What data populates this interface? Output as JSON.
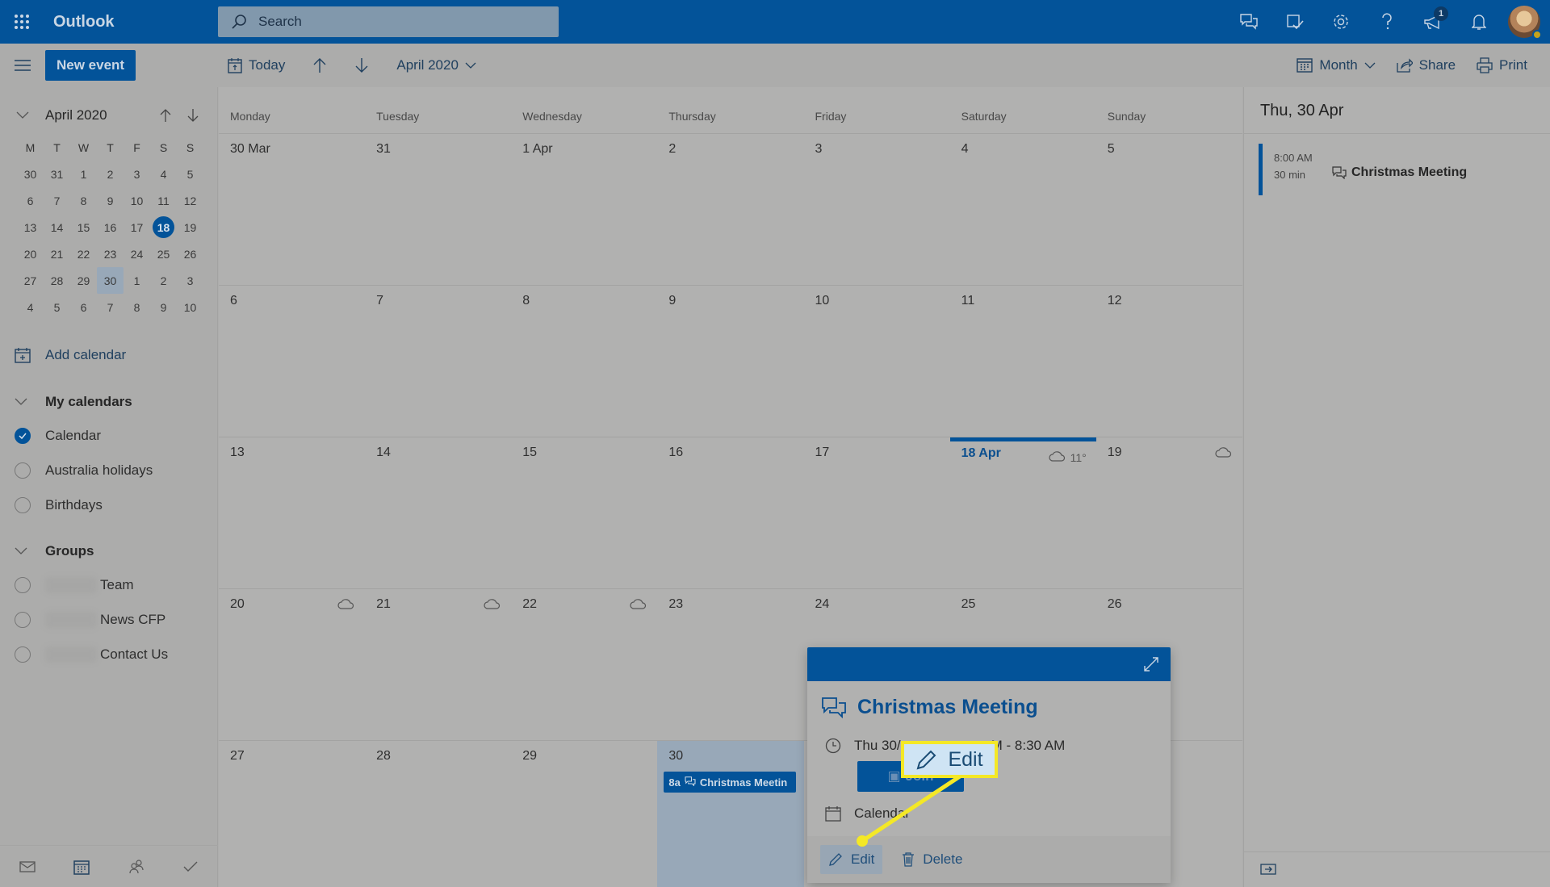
{
  "app": {
    "name": "Outlook",
    "search_placeholder": "Search",
    "notification_count": "1",
    "top_icons": [
      "chat-icon",
      "my-day-icon",
      "settings-icon",
      "help-icon",
      "feedback-megaphone-icon",
      "bell-icon"
    ]
  },
  "toolbar": {
    "new_event": "New event",
    "today": "Today",
    "current_period": "April 2020",
    "view": "Month",
    "share": "Share",
    "print": "Print"
  },
  "mini_calendar": {
    "title": "April 2020",
    "weekdays": [
      "M",
      "T",
      "W",
      "T",
      "F",
      "S",
      "S"
    ],
    "weeks": [
      [
        "30",
        "31",
        "1",
        "2",
        "3",
        "4",
        "5"
      ],
      [
        "6",
        "7",
        "8",
        "9",
        "10",
        "11",
        "12"
      ],
      [
        "13",
        "14",
        "15",
        "16",
        "17",
        "18",
        "19"
      ],
      [
        "20",
        "21",
        "22",
        "23",
        "24",
        "25",
        "26"
      ],
      [
        "27",
        "28",
        "29",
        "30",
        "1",
        "2",
        "3"
      ],
      [
        "4",
        "5",
        "6",
        "7",
        "8",
        "9",
        "10"
      ]
    ],
    "today": "18",
    "selected": "30"
  },
  "sidebar": {
    "add_calendar": "Add calendar",
    "my_calendars_label": "My calendars",
    "my_calendars": [
      {
        "label": "Calendar",
        "checked": true
      },
      {
        "label": "Australia holidays",
        "checked": false
      },
      {
        "label": "Birthdays",
        "checked": false
      }
    ],
    "groups_label": "Groups",
    "groups": [
      {
        "label": "Team",
        "checked": false
      },
      {
        "label": "News CFP",
        "checked": false
      },
      {
        "label": "Contact Us",
        "checked": false
      }
    ],
    "bottom_nav": [
      "mail-icon",
      "calendar-icon",
      "people-icon",
      "todo-icon"
    ]
  },
  "month_view": {
    "weekdays": [
      "Monday",
      "Tuesday",
      "Wednesday",
      "Thursday",
      "Friday",
      "Saturday",
      "Sunday"
    ],
    "weeks": [
      [
        "30 Mar",
        "31",
        "1 Apr",
        "2",
        "3",
        "4",
        "5"
      ],
      [
        "6",
        "7",
        "8",
        "9",
        "10",
        "11",
        "12"
      ],
      [
        "13",
        "14",
        "15",
        "16",
        "17",
        "18 Apr",
        "19"
      ],
      [
        "20",
        "21",
        "22",
        "23",
        "24",
        "25",
        "26"
      ],
      [
        "27",
        "28",
        "29",
        "30",
        "",
        "",
        ""
      ]
    ],
    "today_temp": "11°",
    "event_chip": {
      "time": "8a",
      "title": "Christmas Meetin"
    }
  },
  "agenda": {
    "date": "Thu, 30 Apr",
    "event_time": "8:00 AM",
    "event_duration": "30 min",
    "event_title": "Christmas Meeting"
  },
  "popup": {
    "title": "Christmas Meeting",
    "time_visible_left": "Thu 30/",
    "time_visible_right": "M - 8:30 AM",
    "join": "Join",
    "calendar": "Calendar",
    "edit": "Edit",
    "delete": "Delete"
  },
  "callout": {
    "label": "Edit",
    "color": "#f4e826"
  },
  "colors": {
    "brand": "#035399",
    "accent_text": "#0b4f8f"
  }
}
